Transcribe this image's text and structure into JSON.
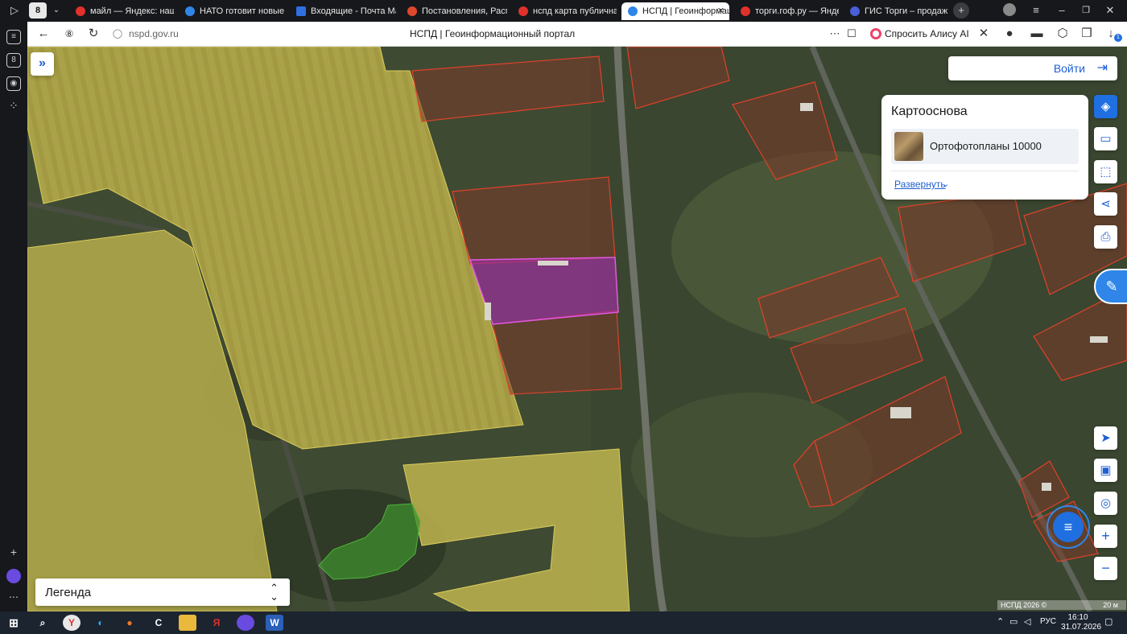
{
  "browser": {
    "tabs": [
      {
        "label": "майл — Яндекс: нашлос",
        "favicon": "yandex-icon",
        "color": "#e0312b"
      },
      {
        "label": "НАТО готовит новые са",
        "favicon": "news-icon",
        "color": "#2f86e8"
      },
      {
        "label": "Входящие - Почта Mail",
        "favicon": "mail-icon",
        "color": "#2f6fe0"
      },
      {
        "label": "Постановления, Распор",
        "favicon": "gov-icon",
        "color": "#e0482b"
      },
      {
        "label": "нспд карта публичная к",
        "favicon": "yandex-icon",
        "color": "#e0312b"
      },
      {
        "label": "НСПД | Геоинформац",
        "favicon": "nspd-icon",
        "color": "#2f86e8"
      },
      {
        "label": "торги.гоф.ру — Яндекс",
        "favicon": "yandex-icon",
        "color": "#e0312b"
      },
      {
        "label": "ГИС Торги – продажи г",
        "favicon": "gis-torgi-icon",
        "color": "#4a5ed8"
      }
    ],
    "active_tab_index": 5,
    "tab_counter": "8",
    "url": "nspd.gov.ru",
    "page_title": "НСПД | Геоинформационный портал",
    "alice_button": "Спросить Алису AI",
    "downloads_badge": "1"
  },
  "map": {
    "expand_sidebar_icon": "double-chevron-right-icon",
    "login_label": "Войти",
    "basemap": {
      "title": "Картооснова",
      "selected": "Ортофотопланы 10000",
      "expand_label": "Развернуть"
    },
    "tools": [
      "layers-icon",
      "ruler-icon",
      "select-area-icon",
      "share-icon",
      "print-icon",
      "locate-icon",
      "minimap-icon",
      "geolocation-icon",
      "zoom-in-icon",
      "zoom-out-icon"
    ],
    "legend_label": "Легенда",
    "attribution": "НСПД 2026 ©",
    "scale_label": "20 м",
    "colors": {
      "field_fill": "#b6ad4c",
      "parcel_outline": "#e0412a",
      "selected_parcel": "#9c2f9c",
      "accent": "#1f6fe0"
    }
  },
  "taskbar": {
    "language": "РУС",
    "time": "16:10",
    "date": "31.07.2026"
  }
}
